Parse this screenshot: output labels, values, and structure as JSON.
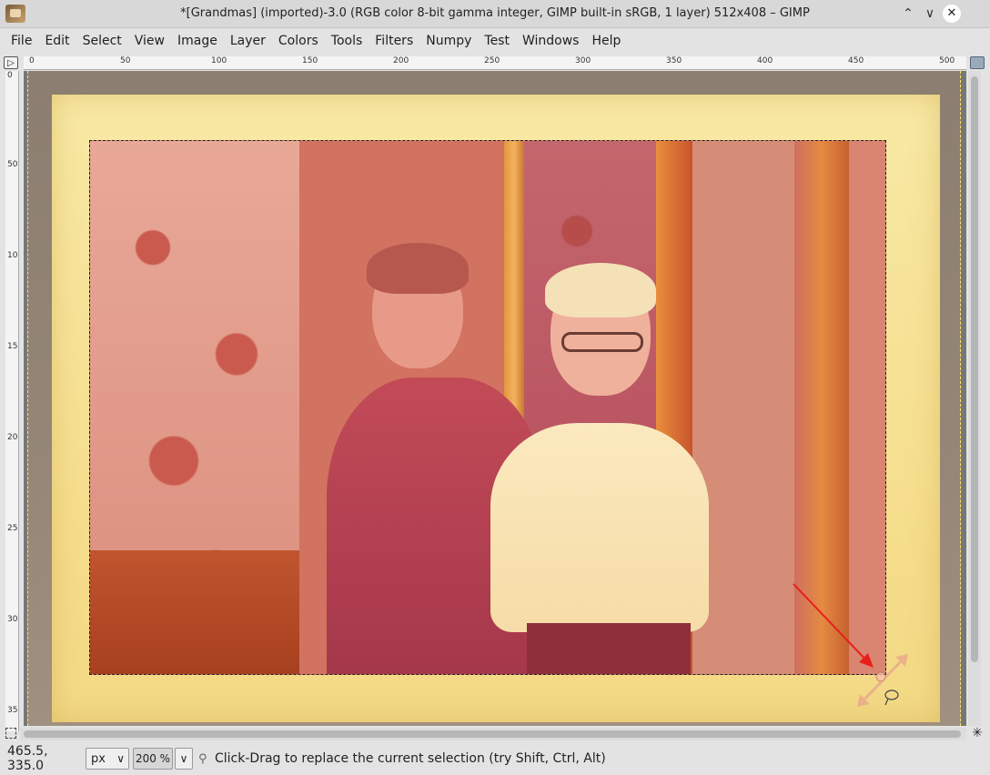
{
  "window": {
    "title": "*[Grandmas] (imported)-3.0 (RGB color 8-bit gamma integer, GIMP built-in sRGB, 1 layer) 512x408 – GIMP",
    "buttons": {
      "collapse_icon": "⌃",
      "minimize_icon": "∨",
      "close_icon": "✕"
    }
  },
  "menubar": {
    "items": [
      "File",
      "Edit",
      "Select",
      "View",
      "Image",
      "Layer",
      "Colors",
      "Tools",
      "Filters",
      "Numpy",
      "Test",
      "Windows",
      "Help"
    ]
  },
  "rulers": {
    "horizontal_ticks": [
      "0",
      "50",
      "100",
      "150",
      "200",
      "250",
      "300",
      "350",
      "400",
      "450",
      "500"
    ],
    "vertical_ticks": [
      "0",
      "50",
      "100",
      "150",
      "200",
      "250",
      "300",
      "350"
    ]
  },
  "statusbar": {
    "coordinates": "465.5, 335.0",
    "unit": "px",
    "zoom": "200 %",
    "message": "Click-Drag to replace the current selection (try Shift, Ctrl, Alt)"
  },
  "colors": {
    "annotation_arrow": "#e8201a",
    "selection_border": "#222222",
    "canvas_border": "#ffe36b"
  }
}
